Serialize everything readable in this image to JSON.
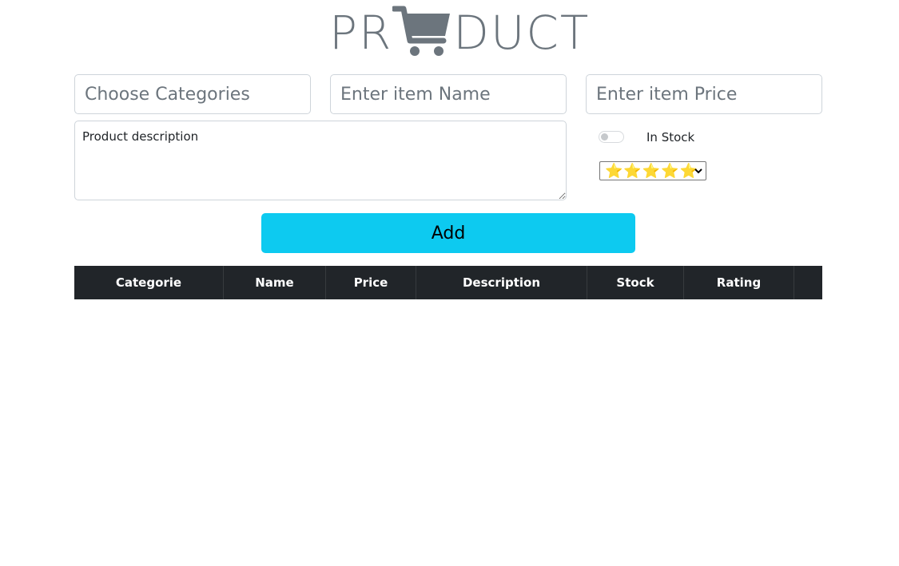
{
  "logo": {
    "left_text": "PR",
    "right_text": "DUCT",
    "icon": "shopping-cart-icon",
    "color": "#6c757d"
  },
  "form": {
    "category_placeholder": "Choose Categories",
    "name_placeholder": "Enter item Name",
    "price_placeholder": "Enter item Price",
    "description_placeholder": "Product description",
    "stock_label": "In Stock",
    "stock_checked": false,
    "rating_selected": "⭐⭐⭐⭐⭐",
    "add_label": "Add"
  },
  "table": {
    "headers": [
      "Categorie",
      "Name",
      "Price",
      "Description",
      "Stock",
      "Rating",
      ""
    ],
    "rows": []
  },
  "colors": {
    "accent": "#0dcaf0",
    "table_header_bg": "#212529",
    "star": "#f5c518"
  }
}
